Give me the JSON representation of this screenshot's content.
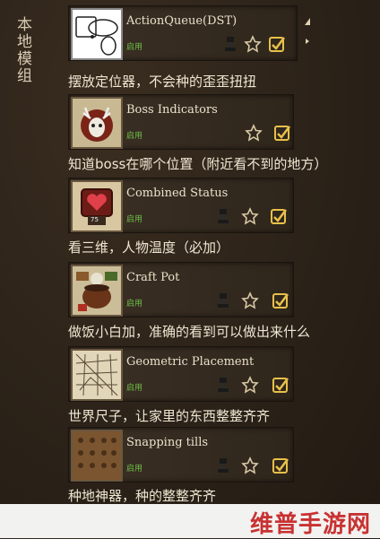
{
  "sidebar": {
    "label": "本地模组"
  },
  "mods": [
    {
      "name": "ActionQueue(DST)",
      "status": "启用",
      "description": "摆放定位器，不会种的歪歪扭扭",
      "thumb_icon": "selection-loop-icon"
    },
    {
      "name": "Boss Indicators",
      "status": "启用",
      "description": "知道boss在哪个位置（附近看不到的地方）",
      "thumb_icon": "deer-skull-icon"
    },
    {
      "name": "Combined Status",
      "status": "启用",
      "description": "看三维，人物温度（必加）",
      "thumb_icon": "heart-badge-icon",
      "thumb_value": "75"
    },
    {
      "name": "Craft Pot",
      "status": "启用",
      "description": "做饭小白加，准确的看到可以做出来什么",
      "thumb_icon": "crock-pot-icon"
    },
    {
      "name": "Geometric Placement",
      "status": "启用",
      "description": "世界尺子，让家里的东西整整齐齐",
      "thumb_icon": "grid-sketch-icon"
    },
    {
      "name": "Snapping tills",
      "status": "启用",
      "description": "种地神器，种的整整齐齐",
      "thumb_icon": "tilled-soil-icon"
    }
  ],
  "watermark": {
    "text": "维普手游网"
  },
  "colors": {
    "enabled": "#6fbf4a",
    "star": "#d9c9a5",
    "checkbox": "#e8c04a"
  }
}
